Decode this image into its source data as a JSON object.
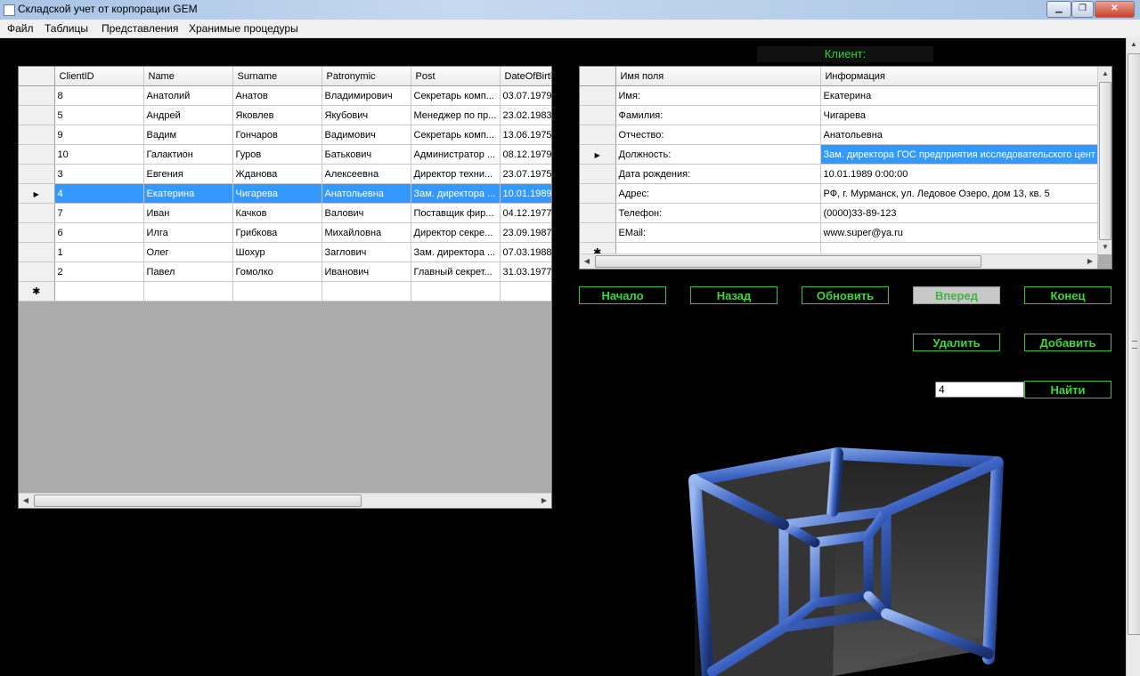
{
  "window": {
    "title": "Складской учет от корпорации GEM",
    "min_glyph": "▁",
    "max_glyph": "❐",
    "close_glyph": "✕"
  },
  "menu": [
    "Файл",
    "Таблицы",
    "Представления",
    "Хранимые процедуры"
  ],
  "clients_grid": {
    "columns": [
      "ClientID",
      "Name",
      "Surname",
      "Patronymic",
      "Post",
      "DateOfBirth"
    ],
    "rows": [
      [
        "8",
        "Анатолий",
        "Анатов",
        "Владимирович",
        "Секретарь комп...",
        "03.07.1979"
      ],
      [
        "5",
        "Андрей",
        "Яковлев",
        "Якубович",
        "Менеджер по пр...",
        "23.02.1983"
      ],
      [
        "9",
        "Вадим",
        "Гончаров",
        "Вадимович",
        "Секретарь комп...",
        "13.06.1975"
      ],
      [
        "10",
        "Галактион",
        "Гуров",
        "Батькович",
        "Администратор ...",
        "08.12.1979"
      ],
      [
        "3",
        "Евгения",
        "Жданова",
        "Алексеевна",
        "Директор техни...",
        "23.07.1975"
      ],
      [
        "4",
        "Екатерина",
        "Чигарева",
        "Анатольевна",
        "Зам. директора ...",
        "10.01.1989"
      ],
      [
        "7",
        "Иван",
        "Качков",
        "Валович",
        "Поставщик фир...",
        "04.12.1977"
      ],
      [
        "6",
        "Илга",
        "Грибкова",
        "Михайловна",
        "Директор секре...",
        "23.09.1987"
      ],
      [
        "1",
        "Олег",
        "Шохур",
        "Заглович",
        "Зам. директора ...",
        "07.03.1988"
      ],
      [
        "2",
        "Павел",
        "Гомолко",
        "Иванович",
        "Главный секрет...",
        "31.03.1977"
      ]
    ],
    "selected_row": 5,
    "new_row_marker": "✱",
    "current_row_marker": "▶"
  },
  "client_label": "Клиент:",
  "detail_grid": {
    "columns": [
      "Имя поля",
      "Информация"
    ],
    "rows": [
      [
        "Имя:",
        "Екатерина"
      ],
      [
        "Фамилия:",
        "Чигарева"
      ],
      [
        "Отчество:",
        "Анатольевна"
      ],
      [
        "Должность:",
        "Зам. директора ГОС предприятия исследовательского цент"
      ],
      [
        "Дата рождения:",
        "10.01.1989 0:00:00"
      ],
      [
        "Адрес:",
        "РФ, г. Мурманск, ул. Ледовое Озеро, дом 13, кв. 5"
      ],
      [
        "Телефон:",
        "(0000)33-89-123"
      ],
      [
        "EMail:",
        "www.super@ya.ru"
      ]
    ],
    "current_row": 3,
    "new_row_marker": "✱",
    "current_row_marker": "▶"
  },
  "nav_buttons": {
    "first": "Начало",
    "prev": "Назад",
    "refresh": "Обновить",
    "next": "Вперед",
    "last": "Конец"
  },
  "action_buttons": {
    "delete": "Удалить",
    "add": "Добавить"
  },
  "search": {
    "value": "4",
    "button": "Найти"
  },
  "colors": {
    "accent_green": "#3cd83c",
    "selection_blue": "#3399ff"
  }
}
